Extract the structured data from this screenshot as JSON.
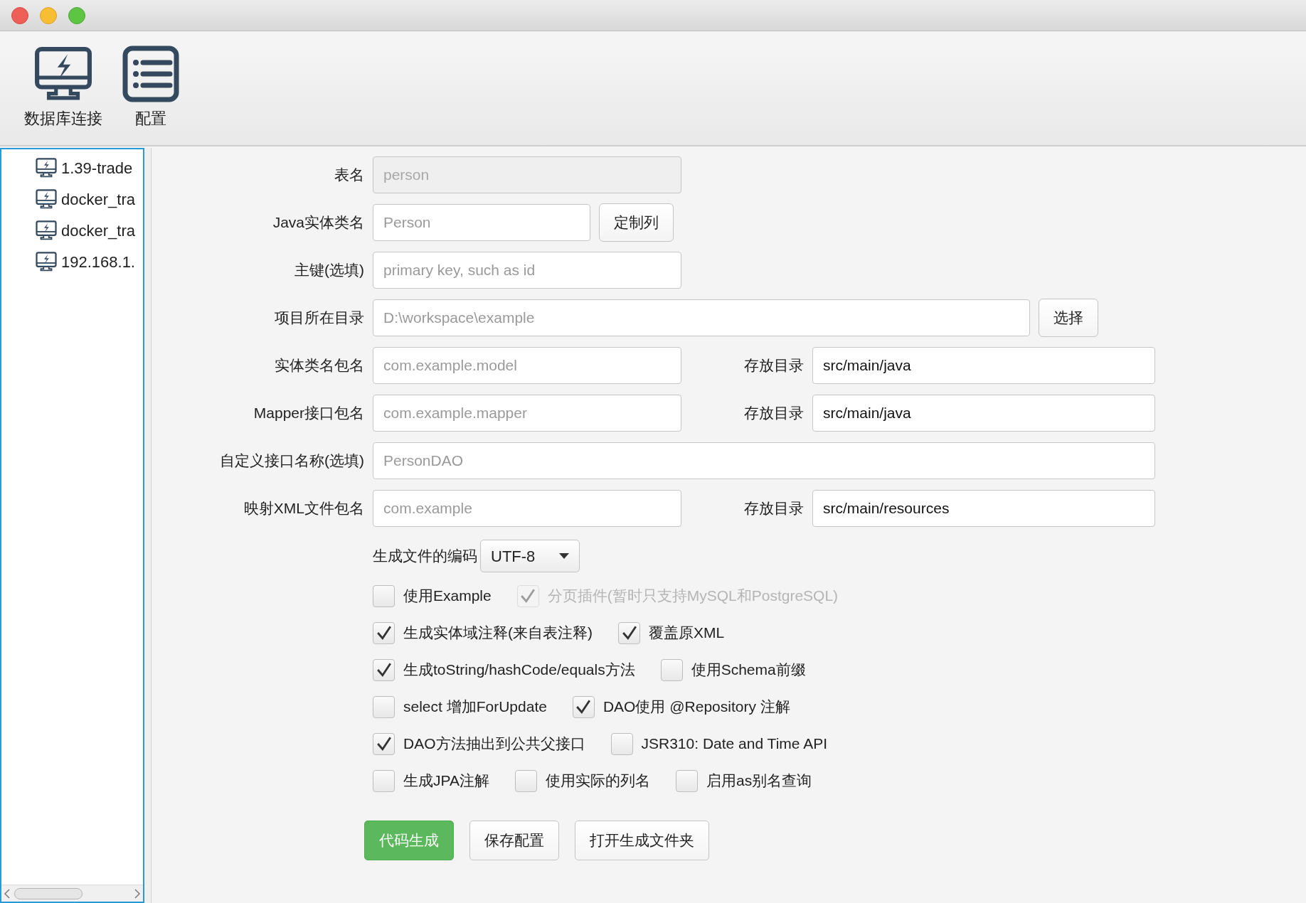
{
  "toolbar": [
    {
      "label": "数据库连接",
      "kind": "connection"
    },
    {
      "label": "配置",
      "kind": "config"
    }
  ],
  "sidebar": {
    "connections": [
      {
        "label": "1.39-trade"
      },
      {
        "label": "docker_tra"
      },
      {
        "label": "docker_tra"
      },
      {
        "label": "192.168.1."
      }
    ]
  },
  "form": {
    "fields": [
      {
        "label": "表名",
        "placeholder": "person",
        "disabled": true,
        "kind": "short"
      },
      {
        "label": "Java实体类名",
        "placeholder": "Person",
        "disabled": false,
        "kind": "narrow",
        "button": "定制列"
      },
      {
        "label": "主键(选填)",
        "placeholder": "primary key, such as id",
        "disabled": false,
        "kind": "short"
      },
      {
        "label": "项目所在目录",
        "placeholder": "D:\\workspace\\example",
        "disabled": false,
        "kind": "wide",
        "button": "选择"
      },
      {
        "label": "实体类名包名",
        "placeholder": "com.example.model",
        "disabled": false,
        "kind": "short",
        "dir_label": "存放目录",
        "dir_value": "src/main/java"
      },
      {
        "label": "Mapper接口包名",
        "placeholder": "com.example.mapper",
        "disabled": false,
        "kind": "short",
        "dir_label": "存放目录",
        "dir_value": "src/main/java"
      },
      {
        "label": "自定义接口名称(选填)",
        "placeholder": "PersonDAO",
        "disabled": false,
        "kind": "full"
      },
      {
        "label": "映射XML文件包名",
        "placeholder": "com.example",
        "disabled": false,
        "kind": "short",
        "dir_label": "存放目录",
        "dir_value": "src/main/resources"
      }
    ],
    "encoding": {
      "label": "生成文件的编码",
      "value": "UTF-8"
    },
    "options": [
      [
        {
          "label": "使用Example",
          "checked": false,
          "disabled": false
        },
        {
          "label": "分页插件(暂时只支持MySQL和PostgreSQL)",
          "checked": true,
          "disabled": true
        }
      ],
      [
        {
          "label": "生成实体域注释(来自表注释)",
          "checked": true,
          "disabled": false
        },
        {
          "label": "覆盖原XML",
          "checked": true,
          "disabled": false
        }
      ],
      [
        {
          "label": "生成toString/hashCode/equals方法",
          "checked": true,
          "disabled": false
        },
        {
          "label": "使用Schema前缀",
          "checked": false,
          "disabled": false
        }
      ],
      [
        {
          "label": "select 增加ForUpdate",
          "checked": false,
          "disabled": false
        },
        {
          "label": "DAO使用 @Repository 注解",
          "checked": true,
          "disabled": false
        }
      ],
      [
        {
          "label": "DAO方法抽出到公共父接口",
          "checked": true,
          "disabled": false
        },
        {
          "label": "JSR310: Date and Time API",
          "checked": false,
          "disabled": false
        }
      ],
      [
        {
          "label": "生成JPA注解",
          "checked": false,
          "disabled": false
        },
        {
          "label": "使用实际的列名",
          "checked": false,
          "disabled": false
        },
        {
          "label": "启用as别名查询",
          "checked": false,
          "disabled": false
        }
      ]
    ],
    "actions": [
      {
        "label": "代码生成",
        "primary": true
      },
      {
        "label": "保存配置",
        "primary": false
      },
      {
        "label": "打开生成文件夹",
        "primary": false
      }
    ]
  }
}
